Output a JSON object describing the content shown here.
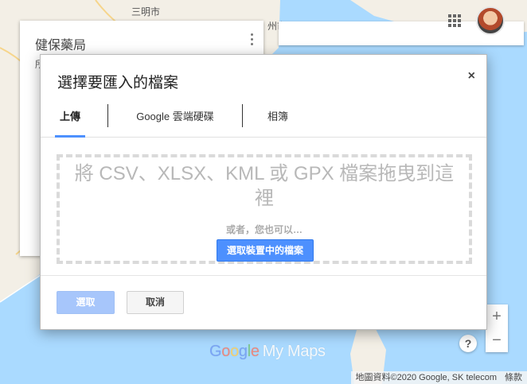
{
  "map": {
    "city_labels": [
      "三明市",
      "州市"
    ],
    "panel_title": "健保藥局",
    "panel_sub": "所",
    "logo_letters": [
      "G",
      "o",
      "o",
      "g",
      "l",
      "e"
    ],
    "logo_suffix": "My Maps",
    "zoom_in": "+",
    "zoom_out": "−",
    "help": "?",
    "attribution": "地圖資料©2020 Google, SK telecom",
    "terms": "條款"
  },
  "dialog": {
    "title": "選擇要匯入的檔案",
    "close": "×",
    "tabs": [
      {
        "label": "上傳",
        "active": true
      },
      {
        "label": "Google 雲端硬碟",
        "active": false
      },
      {
        "label": "相簿",
        "active": false
      }
    ],
    "drop_text": "將 CSV、XLSX、KML 或 GPX 檔案拖曳到這裡",
    "or_text": "或者，您也可以…",
    "select_file_button": "選取裝置中的檔案",
    "select_button": "選取",
    "cancel_button": "取消"
  },
  "colors": {
    "accent": "#4d90fe",
    "select_disabled": "#a7c6fb",
    "land": "#f3efe6",
    "water": "#aadaff"
  }
}
